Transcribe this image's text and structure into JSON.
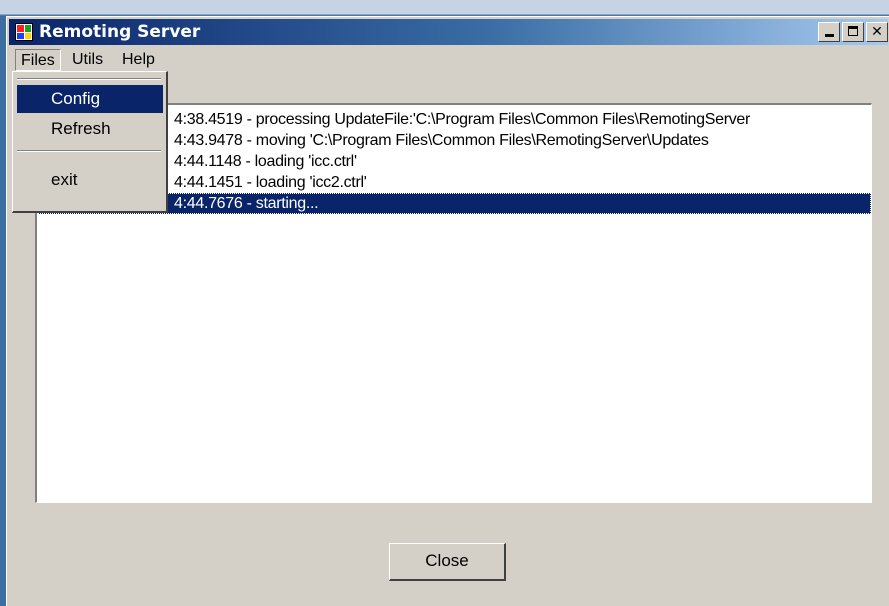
{
  "window": {
    "title": "Remoting Server"
  },
  "menu": {
    "items": [
      {
        "label": "Files"
      },
      {
        "label": "Utils"
      },
      {
        "label": "Help"
      }
    ]
  },
  "files_menu": {
    "items": [
      {
        "label": "Config"
      },
      {
        "label": "Refresh"
      },
      {
        "label": "exit"
      }
    ]
  },
  "log": {
    "rows": [
      "4:38.4519 - processing UpdateFile:'C:\\Program Files\\Common Files\\RemotingServer",
      "4:43.9478 - moving 'C:\\Program Files\\Common Files\\RemotingServer\\Updates",
      "4:44.1148 - loading 'icc.ctrl'",
      "4:44.1451 - loading 'icc2.ctrl'",
      "4:44.7676 - starting..."
    ],
    "selected_index": 4
  },
  "buttons": {
    "close_label": "Close"
  },
  "colors": {
    "selection": "#0a246a",
    "face": "#d4d0c8"
  }
}
